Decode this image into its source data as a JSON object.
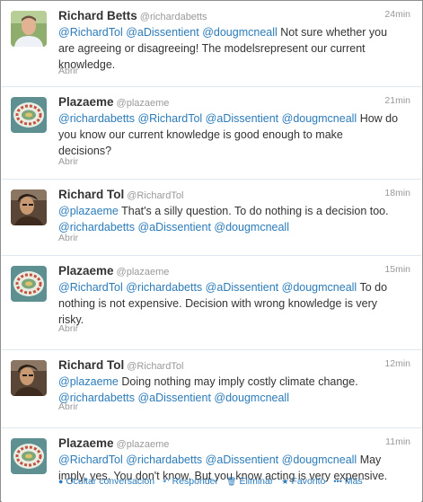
{
  "colors": {
    "link": "#2b7bb9",
    "meta": "#999999",
    "text": "#333333",
    "border": "#e1e8ed"
  },
  "tweets": [
    {
      "name": "Richard Betts",
      "handle": "@richardabetts",
      "time": "24min",
      "avatar": "richard-betts-photo",
      "lines": [
        [
          [
            "mention",
            "@RichardTol"
          ],
          [
            "text",
            " "
          ],
          [
            "mention",
            "@aDissentient"
          ],
          [
            "text",
            " "
          ],
          [
            "mention",
            "@dougmcneall"
          ],
          [
            "text",
            " Not sure whether you"
          ]
        ],
        [
          [
            "text",
            "are agreeing or disagreeing! The modelsrepresent our current"
          ]
        ],
        [
          [
            "text",
            "knowledge."
          ]
        ]
      ],
      "footer": "Abrir"
    },
    {
      "name": "Plazaeme",
      "handle": "@plazaeme",
      "time": "21min",
      "avatar": "plazaeme-logo",
      "lines": [
        [
          [
            "mention",
            "@richardabetts"
          ],
          [
            "text",
            " "
          ],
          [
            "mention",
            "@RichardTol"
          ],
          [
            "text",
            " "
          ],
          [
            "mention",
            "@aDissentient"
          ],
          [
            "text",
            " "
          ],
          [
            "mention",
            "@dougmcneall"
          ],
          [
            "text",
            " How do"
          ]
        ],
        [
          [
            "text",
            "you know our current knowledge is good enough to make"
          ]
        ],
        [
          [
            "text",
            "decisions?"
          ]
        ]
      ],
      "footer": "Abrir"
    },
    {
      "name": "Richard Tol",
      "handle": "@RichardTol",
      "time": "18min",
      "avatar": "richard-tol-photo",
      "lines": [
        [
          [
            "mention",
            "@plazaeme"
          ],
          [
            "text",
            " That's a silly question. To do nothing is a decision too."
          ]
        ],
        [
          [
            "mention",
            "@richardabetts"
          ],
          [
            "text",
            " "
          ],
          [
            "mention",
            "@aDissentient"
          ],
          [
            "text",
            " "
          ],
          [
            "mention",
            "@dougmcneall"
          ]
        ]
      ],
      "footer": "Abrir"
    },
    {
      "name": "Plazaeme",
      "handle": "@plazaeme",
      "time": "15min",
      "avatar": "plazaeme-logo",
      "lines": [
        [
          [
            "mention",
            "@RichardTol"
          ],
          [
            "text",
            " "
          ],
          [
            "mention",
            "@richardabetts"
          ],
          [
            "text",
            " "
          ],
          [
            "mention",
            "@aDissentient"
          ],
          [
            "text",
            " "
          ],
          [
            "mention",
            "@dougmcneall"
          ],
          [
            "text",
            " To do"
          ]
        ],
        [
          [
            "text",
            "nothing is not expensive. Decision with wrong knowledge is very"
          ]
        ],
        [
          [
            "text",
            "risky."
          ]
        ]
      ],
      "footer": "Abrir"
    },
    {
      "name": "Richard Tol",
      "handle": "@RichardTol",
      "time": "12min",
      "avatar": "richard-tol-photo",
      "lines": [
        [
          [
            "mention",
            "@plazaeme"
          ],
          [
            "text",
            " Doing nothing may imply costly climate change."
          ]
        ],
        [
          [
            "mention",
            "@richardabetts"
          ],
          [
            "text",
            " "
          ],
          [
            "mention",
            "@aDissentient"
          ],
          [
            "text",
            " "
          ],
          [
            "mention",
            "@dougmcneall"
          ]
        ]
      ],
      "footer": "Abrir"
    },
    {
      "name": "Plazaeme",
      "handle": "@plazaeme",
      "time": "11min",
      "avatar": "plazaeme-logo",
      "lines": [
        [
          [
            "mention",
            "@RichardTol"
          ],
          [
            "text",
            " "
          ],
          [
            "mention",
            "@richardabetts"
          ],
          [
            "text",
            " "
          ],
          [
            "mention",
            "@aDissentient"
          ],
          [
            "text",
            " "
          ],
          [
            "mention",
            "@dougmcneall"
          ],
          [
            "text",
            " May"
          ]
        ],
        [
          [
            "text",
            "imply, yes. You don't know. But you know acting is very expensive."
          ]
        ]
      ],
      "actions": [
        {
          "icon": "conversation-icon",
          "glyph": "●",
          "label": "Ocultar conversación"
        },
        {
          "icon": "reply-icon",
          "glyph": "↶",
          "label": "Responder"
        },
        {
          "icon": "trash-icon",
          "glyph": "🗑",
          "label": "Eliminar"
        },
        {
          "icon": "star-icon",
          "glyph": "★",
          "label": "Favorito"
        },
        {
          "icon": "more-icon",
          "glyph": "•••",
          "label": "Más"
        }
      ]
    }
  ]
}
